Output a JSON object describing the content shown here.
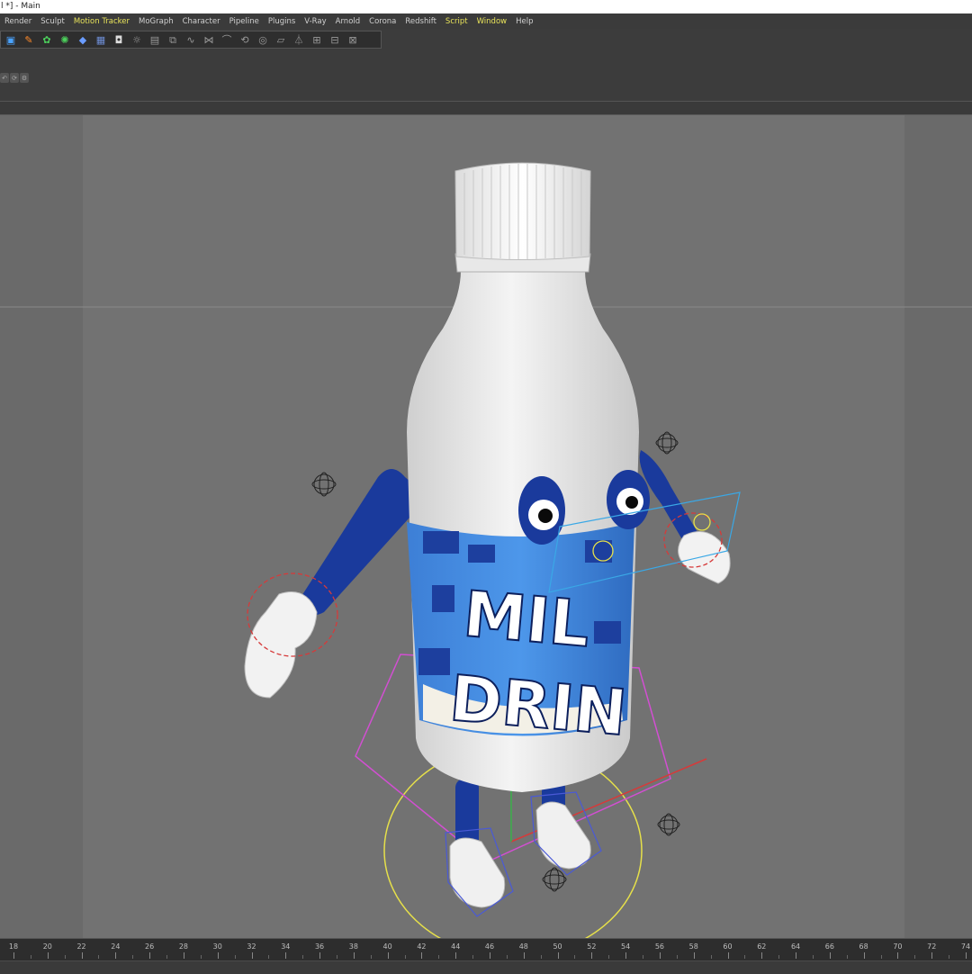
{
  "window": {
    "title": "l *] - Main"
  },
  "menu": [
    {
      "label": "Render",
      "hl": false
    },
    {
      "label": "Sculpt",
      "hl": false
    },
    {
      "label": "Motion Tracker",
      "hl": true
    },
    {
      "label": "MoGraph",
      "hl": false
    },
    {
      "label": "Character",
      "hl": false
    },
    {
      "label": "Pipeline",
      "hl": false
    },
    {
      "label": "Plugins",
      "hl": false
    },
    {
      "label": "V-Ray",
      "hl": false
    },
    {
      "label": "Arnold",
      "hl": false
    },
    {
      "label": "Corona",
      "hl": false
    },
    {
      "label": "Redshift",
      "hl": false
    },
    {
      "label": "Script",
      "hl": true
    },
    {
      "label": "Window",
      "hl": true
    },
    {
      "label": "Help",
      "hl": false
    }
  ],
  "toolbar": {
    "icons": [
      "cube-icon",
      "pen-icon",
      "subdivide-icon",
      "array-icon",
      "deformer-icon",
      "floor-icon",
      "camera-icon",
      "light-icon",
      "grid-icon",
      "symmetry-icon",
      "spline-icon",
      "connect-icon",
      "bend-icon",
      "twist-icon",
      "bulge-icon",
      "shear-icon",
      "taper-icon",
      "wrap-icon",
      "lattice-icon",
      "mesh-icon"
    ]
  },
  "viewport": {
    "label_text": [
      "MIL",
      "DRIN"
    ]
  },
  "timeline": {
    "ticks": [
      18,
      20,
      22,
      24,
      26,
      28,
      30,
      32,
      34,
      36,
      38,
      40,
      42,
      44,
      46,
      48,
      50,
      52,
      54,
      56,
      58,
      60,
      62,
      64,
      66,
      68,
      70,
      72,
      74
    ]
  },
  "colors": {
    "accent_menu": "#e8e35a",
    "bottle_blue": "#1a3a9c",
    "rig_magenta": "#d24fd2",
    "rig_red": "#d63a3a",
    "rig_yellow": "#e6e04a",
    "rig_cyan": "#3aa8e6"
  }
}
